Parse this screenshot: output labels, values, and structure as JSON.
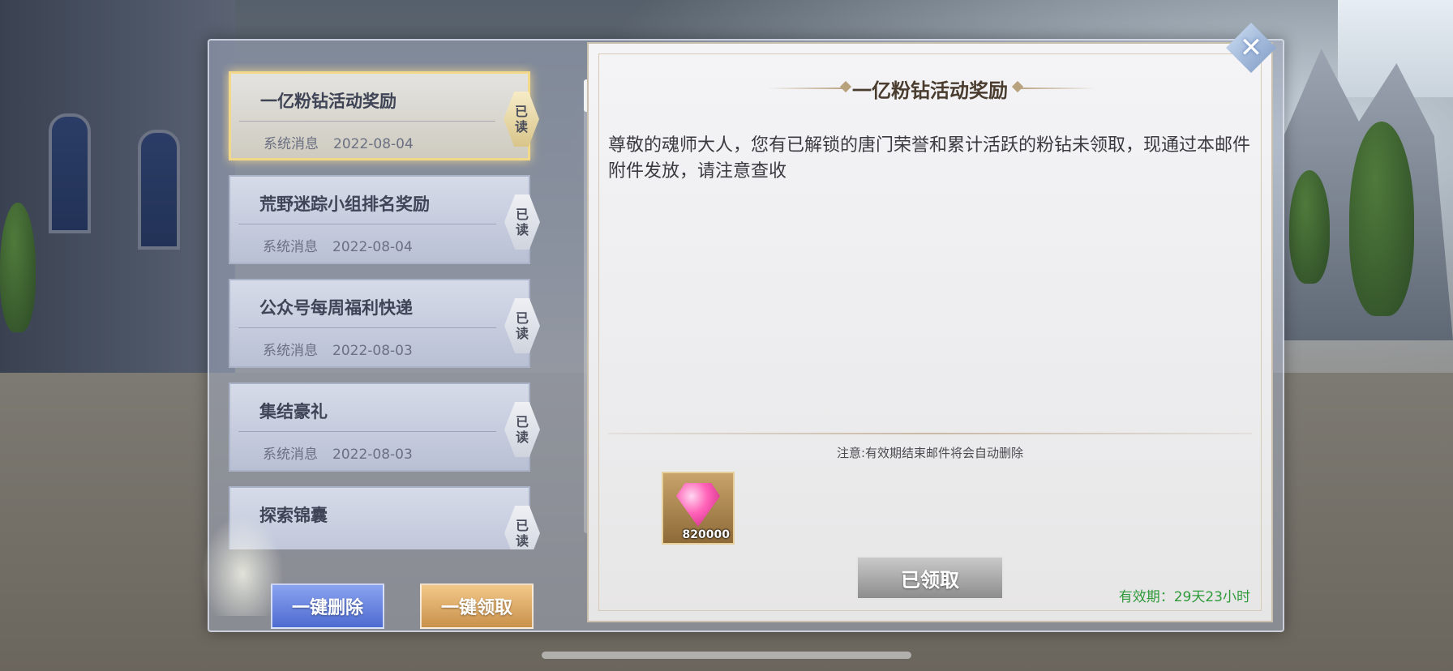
{
  "mail_list": [
    {
      "title": "一亿粉钻活动奖励",
      "sender": "系统消息",
      "date": "2022-08-04",
      "status": "已读",
      "active": true
    },
    {
      "title": "荒野迷踪小组排名奖励",
      "sender": "系统消息",
      "date": "2022-08-04",
      "status": "已读",
      "active": false
    },
    {
      "title": "公众号每周福利快递",
      "sender": "系统消息",
      "date": "2022-08-03",
      "status": "已读",
      "active": false
    },
    {
      "title": "集结豪礼",
      "sender": "系统消息",
      "date": "2022-08-03",
      "status": "已读",
      "active": false
    },
    {
      "title": "探索锦囊",
      "sender": "",
      "date": "",
      "status": "已读",
      "active": false
    }
  ],
  "buttons": {
    "delete_all": "一键删除",
    "claim_all": "一键领取"
  },
  "mail_detail": {
    "title": "一亿粉钻活动奖励",
    "body": "尊敬的魂师大人，您有已解锁的唐门荣誉和累计活跃的粉钻未领取，现通过本邮件附件发放，请注意查收",
    "note": "注意:有效期结束邮件将会自动删除",
    "attachment": {
      "icon": "pink-diamond-icon",
      "count": "820000"
    },
    "claimed_button": "已领取",
    "validity": "有效期：29天23小时"
  },
  "colors": {
    "validity_green": "#2f9a3a",
    "active_border": "#f2d98a"
  }
}
